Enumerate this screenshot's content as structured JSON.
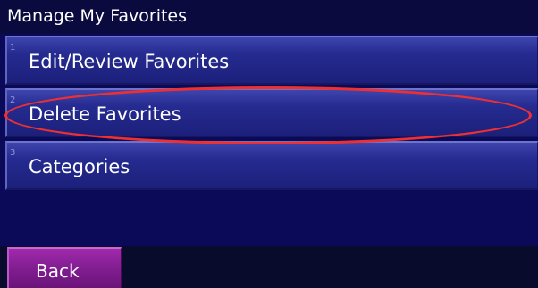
{
  "screen": {
    "title": "Manage My Favorites"
  },
  "menu": {
    "items": [
      {
        "number": "1",
        "label": "Edit/Review Favorites"
      },
      {
        "number": "2",
        "label": "Delete Favorites"
      },
      {
        "number": "3",
        "label": "Categories"
      }
    ]
  },
  "footer": {
    "back_label": "Back"
  },
  "colors": {
    "title_bar": "#0a0a3f",
    "menu_item": "#252b90",
    "back_button": "#821e92",
    "highlight": "#ef3030"
  }
}
